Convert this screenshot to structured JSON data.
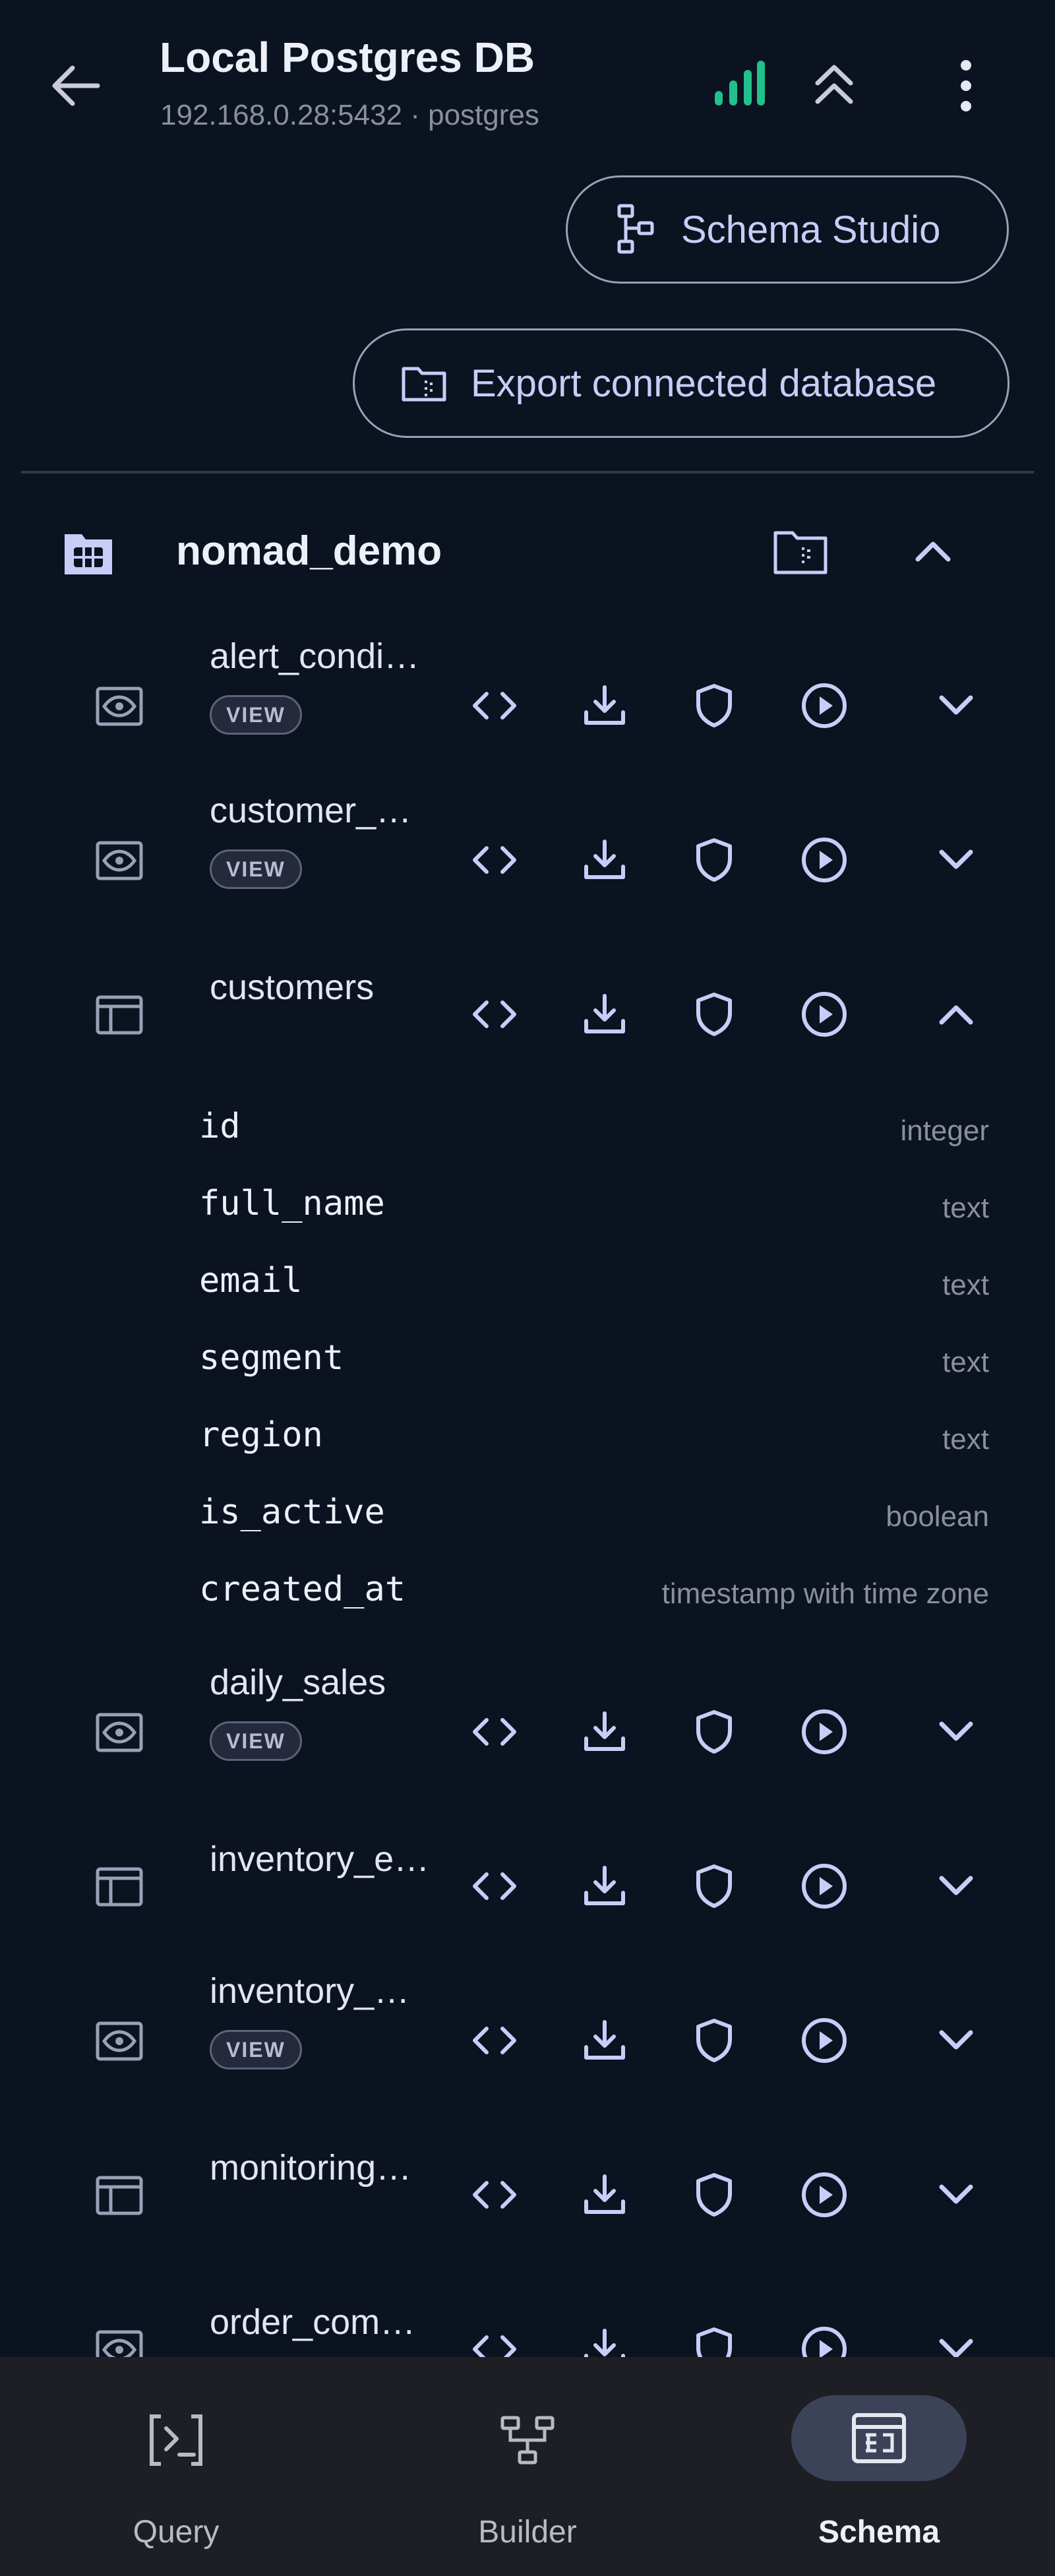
{
  "header": {
    "title": "Local Postgres DB",
    "subtitle": "192.168.0.28:5432 · postgres",
    "back_icon": "arrow-left-icon",
    "signal_icon": "signal-bars-icon",
    "collapse_icon": "chevrons-up-icon",
    "more_icon": "more-vertical-icon",
    "signal_color": "#22c08a"
  },
  "actions": {
    "schema_studio_label": "Schema Studio",
    "export_label": "Export connected database"
  },
  "schema": {
    "name": "nomad_demo",
    "objects": [
      {
        "name": "alert_condi…",
        "kind": "view",
        "badge": "VIEW",
        "expanded": false
      },
      {
        "name": "customer_…",
        "kind": "view",
        "badge": "VIEW",
        "expanded": false
      },
      {
        "name": "customers",
        "kind": "table",
        "badge": "",
        "expanded": true
      },
      {
        "name": "daily_sales",
        "kind": "view",
        "badge": "VIEW",
        "expanded": false
      },
      {
        "name": "inventory_e…",
        "kind": "table",
        "badge": "",
        "expanded": false
      },
      {
        "name": "inventory_…",
        "kind": "view",
        "badge": "VIEW",
        "expanded": false
      },
      {
        "name": "monitoring…",
        "kind": "table",
        "badge": "",
        "expanded": false
      },
      {
        "name": "order_com…",
        "kind": "view",
        "badge": "",
        "expanded": false
      }
    ],
    "columns": [
      {
        "name": "id",
        "type": "integer"
      },
      {
        "name": "full_name",
        "type": "text"
      },
      {
        "name": "email",
        "type": "text"
      },
      {
        "name": "segment",
        "type": "text"
      },
      {
        "name": "region",
        "type": "text"
      },
      {
        "name": "is_active",
        "type": "boolean"
      },
      {
        "name": "created_at",
        "type": "timestamp with time zone"
      }
    ]
  },
  "nav": {
    "query_label": "Query",
    "builder_label": "Builder",
    "schema_label": "Schema",
    "active": "Schema"
  },
  "colors": {
    "background": "#0b1220",
    "accent": "#c8cdf7",
    "nav_background": "#1e1f24",
    "nav_active_pill": "#3c4258"
  }
}
